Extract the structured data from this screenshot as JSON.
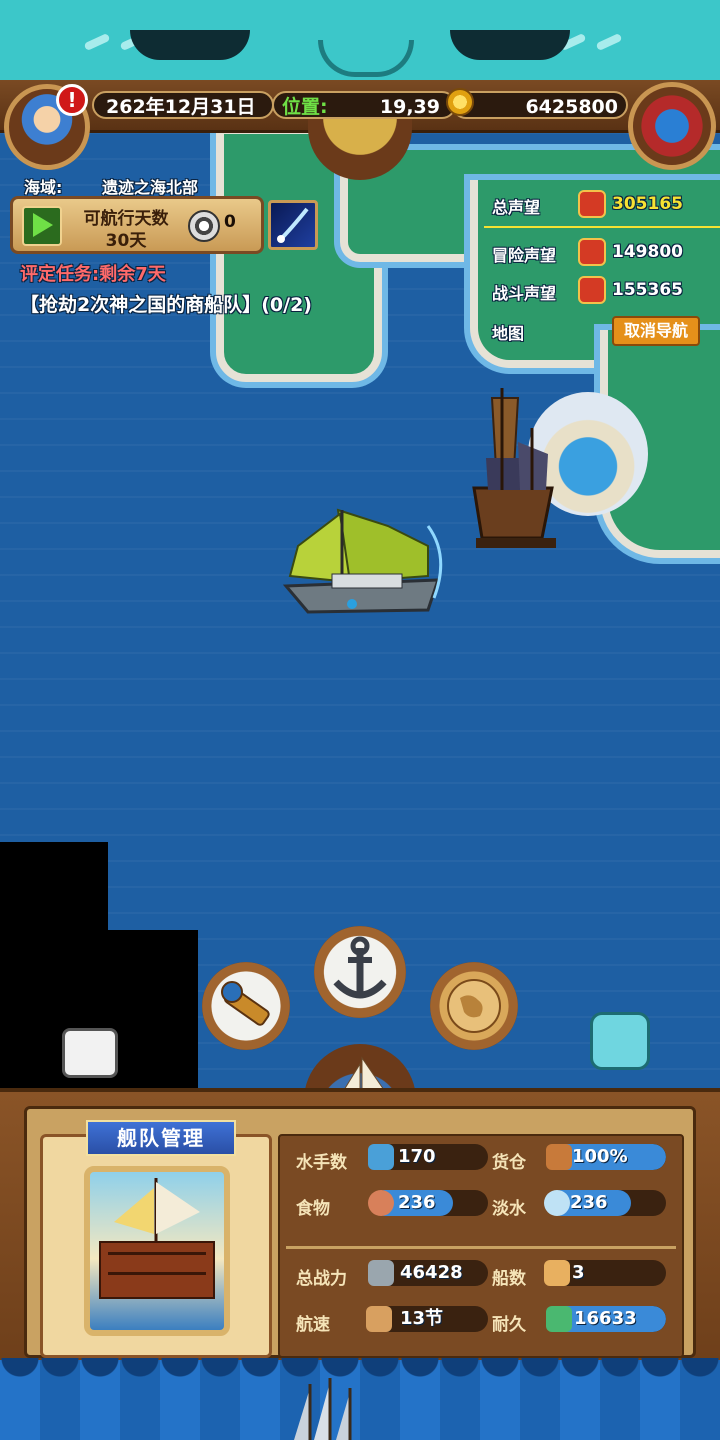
{
  "status": {
    "date": "262年12月31日",
    "position_label": "位置:",
    "position_value": "19,39",
    "gold": "6425800"
  },
  "sea_area": {
    "label": "海域:",
    "value": "遗迹之海北部"
  },
  "sail_days": {
    "label": "可航行天数",
    "value": "30天",
    "coin_count": "0"
  },
  "quest": {
    "timer": "评定任务:剩余7天",
    "text": "【抢劫2次神之国的商船队】(0/2)"
  },
  "reputation": [
    {
      "label": "总声望",
      "shown": "总声望",
      "value": "305165",
      "color": "#f6e233"
    },
    {
      "label": "冒险声望",
      "shown": "冒险声望",
      "value": "149800",
      "color": "#ffffff"
    },
    {
      "label": "战斗声望",
      "shown": "战斗声望",
      "value": "155365",
      "color": "#ffffff"
    }
  ],
  "map_label": "地图",
  "cancel_nav": "取消导航",
  "fleet_panel": {
    "title": "舰队管理",
    "stats": [
      {
        "label": "水手数",
        "value": "170",
        "fill": 0.18,
        "icon": "sailor-icon"
      },
      {
        "label": "货仓",
        "value": "100%",
        "fill": 1.0,
        "icon": "crate-icon"
      },
      {
        "label": "食物",
        "value": "236",
        "fill": 0.7,
        "icon": "meat-icon"
      },
      {
        "label": "淡水",
        "value": "236",
        "fill": 0.7,
        "icon": "water-jug-icon"
      },
      {
        "label": "总战力",
        "value": "46428",
        "fill": 0,
        "icon": "crossed-swords-icon"
      },
      {
        "label": "船数",
        "value": "3",
        "fill": 0,
        "icon": "ship-count-icon"
      },
      {
        "label": "航速",
        "value": "13节",
        "fill": 0,
        "icon": "speed-ship-icon"
      },
      {
        "label": "耐久",
        "value": "16633",
        "fill": 1.0,
        "icon": "durability-icon"
      }
    ]
  },
  "colors": {
    "accent_blue": "#3a8ad8",
    "alert_red": "#d01818",
    "quest_timer": "#ff6a6a",
    "position_green": "#6fe046"
  }
}
